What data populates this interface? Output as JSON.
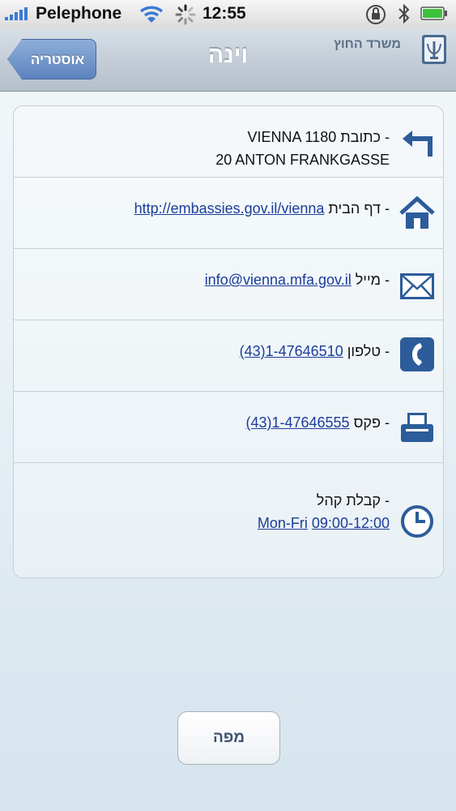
{
  "status_bar": {
    "carrier": "Pelephone",
    "time": "12:55"
  },
  "nav": {
    "back_label": "אוסטריה",
    "title": "וינה",
    "ministry": "משרד החוץ"
  },
  "rows": {
    "address": {
      "label": "כתובת -",
      "line1": "VIENNA 1180",
      "line2": "20 ANTON FRANKGASSE"
    },
    "homepage": {
      "label": "דף הבית -",
      "value": "http://embassies.gov.il/vienna"
    },
    "email": {
      "label": "מייל -",
      "value": "info@vienna.mfa.gov.il"
    },
    "phone": {
      "label": "טלפון -",
      "value": "(43)1-47646510"
    },
    "fax": {
      "label": "פקס -",
      "value": "(43)1-47646555"
    },
    "hours": {
      "label": "קבלת קהל -",
      "days": "Mon-Fri",
      "time": "09:00-12:00"
    }
  },
  "map_button": "מפה",
  "colors": {
    "accent": "#3d6fb5",
    "link": "#1a3d9b"
  }
}
